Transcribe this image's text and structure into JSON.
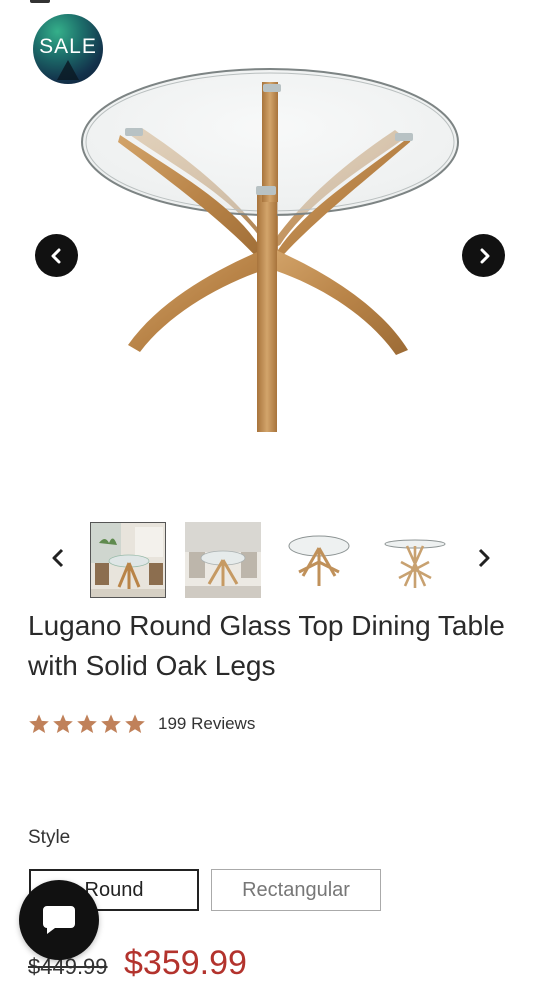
{
  "badge": {
    "label": "SALE"
  },
  "gallery": {
    "thumbnails": [
      {
        "name": "room-scene-1",
        "active": true
      },
      {
        "name": "room-scene-2",
        "active": false
      },
      {
        "name": "round-table-view",
        "active": false
      },
      {
        "name": "round-table-side",
        "active": false
      }
    ]
  },
  "product": {
    "title": "Lugano Round Glass Top Dining Table with Solid Oak Legs",
    "rating": 5,
    "review_count": "199 Reviews",
    "style_label": "Style",
    "style_options": [
      "Round",
      "Rectangular"
    ],
    "selected_style": "Round",
    "price_original": "$449.99",
    "price_sale": "$359.99"
  },
  "colors": {
    "star": "#c0815a",
    "sale_price": "#b3332d",
    "button_dark": "#111111"
  }
}
